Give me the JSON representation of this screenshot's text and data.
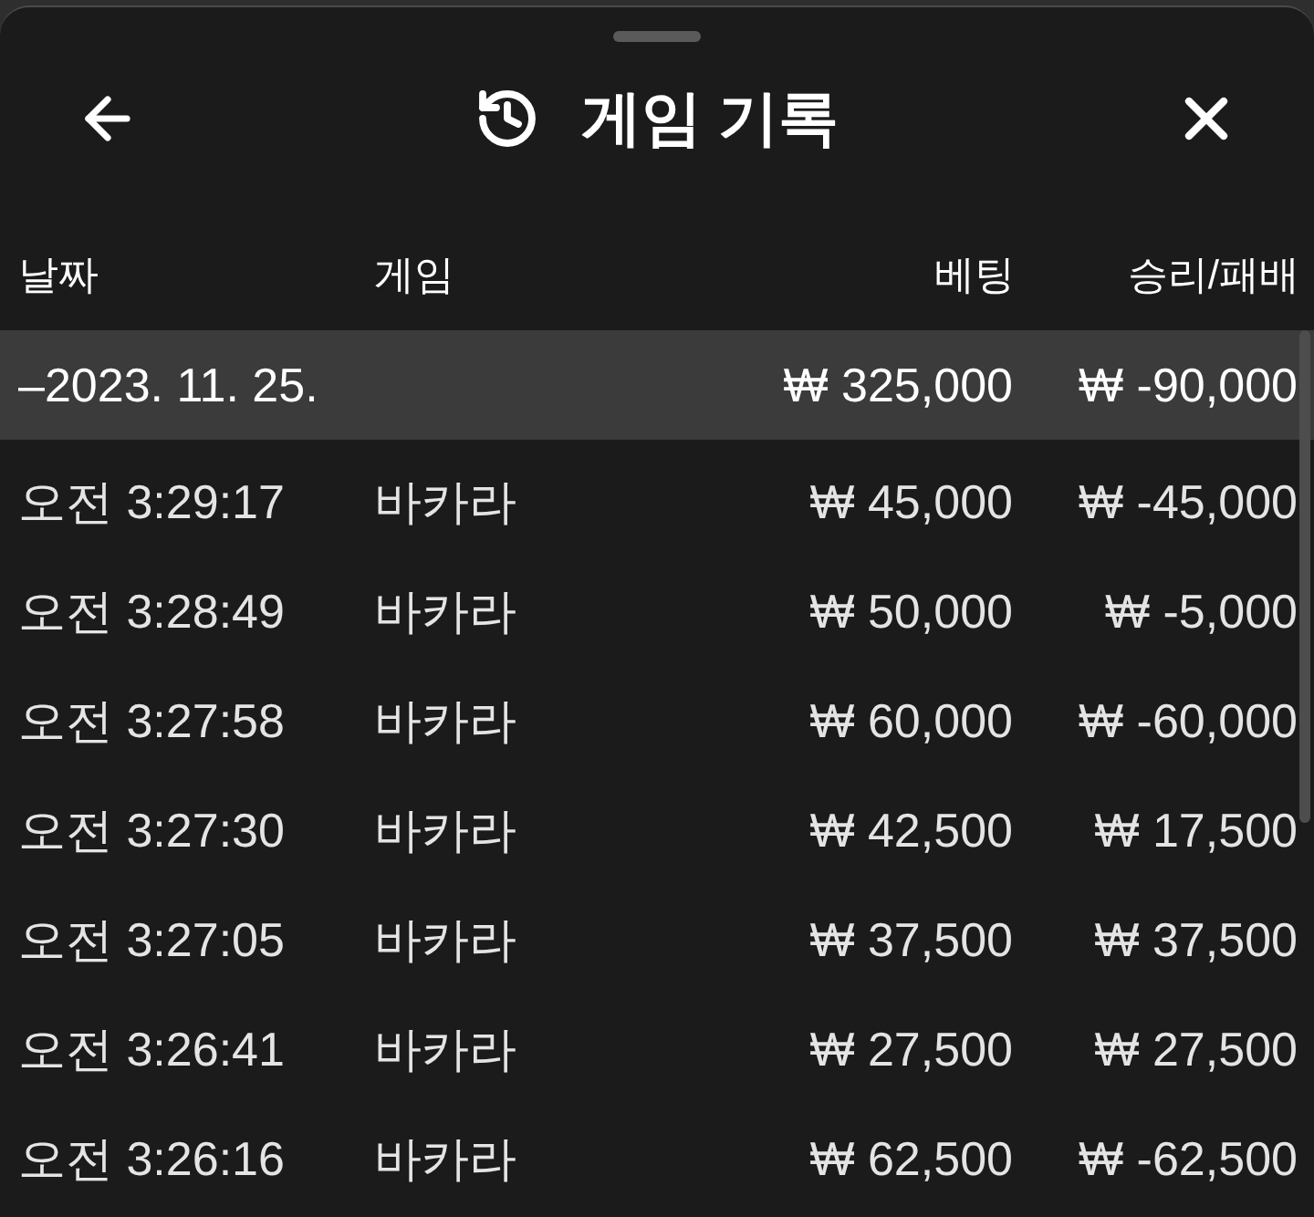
{
  "header": {
    "title": "게임 기록"
  },
  "columns": [
    "날짜",
    "게임",
    "베팅",
    "승리/패배"
  ],
  "groups": [
    {
      "date": "–2023. 11. 25.",
      "bet": "₩ 325,000",
      "result": "₩ -90,000",
      "children": [
        {
          "time": "오전 3:29:17",
          "game": "바카라",
          "bet": "₩ 45,000",
          "result": "₩ -45,000"
        },
        {
          "time": "오전 3:28:49",
          "game": "바카라",
          "bet": "₩ 50,000",
          "result": "₩ -5,000"
        },
        {
          "time": "오전 3:27:58",
          "game": "바카라",
          "bet": "₩ 60,000",
          "result": "₩ -60,000"
        },
        {
          "time": "오전 3:27:30",
          "game": "바카라",
          "bet": "₩ 42,500",
          "result": "₩ 17,500"
        },
        {
          "time": "오전 3:27:05",
          "game": "바카라",
          "bet": "₩ 37,500",
          "result": "₩ 37,500"
        },
        {
          "time": "오전 3:26:41",
          "game": "바카라",
          "bet": "₩ 27,500",
          "result": "₩ 27,500"
        },
        {
          "time": "오전 3:26:16",
          "game": "바카라",
          "bet": "₩ 62,500",
          "result": "₩ -62,500"
        }
      ]
    }
  ]
}
